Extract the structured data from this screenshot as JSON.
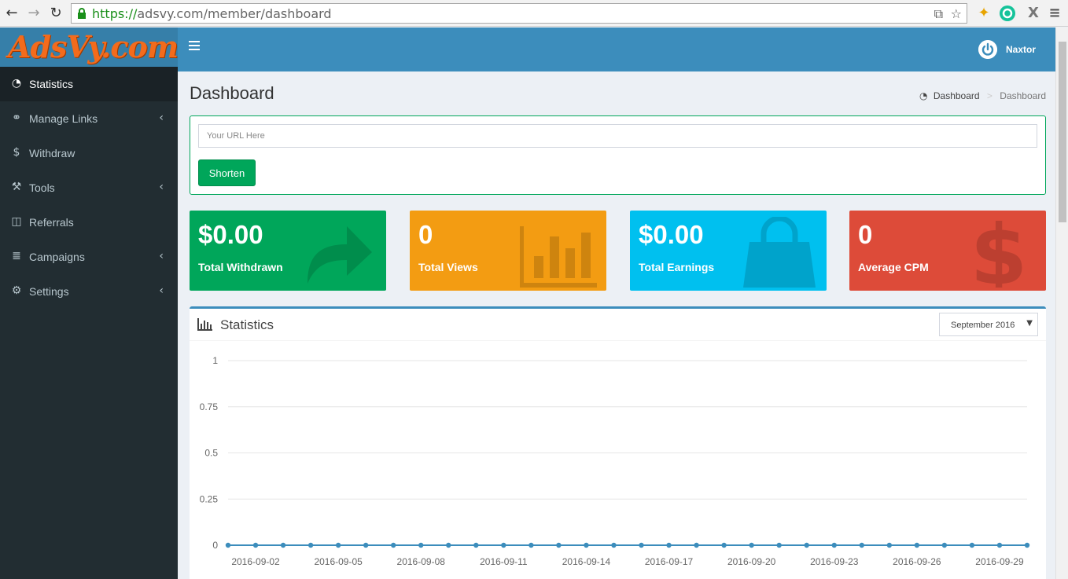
{
  "browser": {
    "url_scheme": "https://",
    "url_rest": "adsvy.com/member/dashboard"
  },
  "sidebar": {
    "logo_text": "AdsVy.com",
    "items": [
      {
        "label": "Statistics",
        "icon": "dashboard-icon",
        "active": true,
        "has_chevron": false
      },
      {
        "label": "Manage Links",
        "icon": "link-icon",
        "active": false,
        "has_chevron": true
      },
      {
        "label": "Withdraw",
        "icon": "dollar-icon",
        "active": false,
        "has_chevron": false
      },
      {
        "label": "Tools",
        "icon": "wrench-icon",
        "active": false,
        "has_chevron": true
      },
      {
        "label": "Referrals",
        "icon": "columns-icon",
        "active": false,
        "has_chevron": false
      },
      {
        "label": "Campaigns",
        "icon": "database-icon",
        "active": false,
        "has_chevron": true
      },
      {
        "label": "Settings",
        "icon": "gears-icon",
        "active": false,
        "has_chevron": true
      }
    ]
  },
  "header": {
    "user_name": "Naxtor"
  },
  "page": {
    "title": "Dashboard",
    "breadcrumb": [
      "Dashboard",
      "Dashboard"
    ]
  },
  "shorten": {
    "placeholder": "Your URL Here",
    "button_label": "Shorten"
  },
  "stat_boxes": [
    {
      "value": "$0.00",
      "label": "Total Withdrawn",
      "color": "#00a65a",
      "icon": "share-arrow-icon"
    },
    {
      "value": "0",
      "label": "Total Views",
      "color": "#f39c12",
      "icon": "bar-chart-icon"
    },
    {
      "value": "$0.00",
      "label": "Total Earnings",
      "color": "#00c0ef",
      "icon": "shopping-bag-icon"
    },
    {
      "value": "0",
      "label": "Average CPM",
      "color": "#dd4b39",
      "icon": "dollar-sign-icon"
    }
  ],
  "statistics": {
    "title": "Statistics",
    "selected_month": "September 2016"
  },
  "chart_data": {
    "type": "line",
    "x": [
      "2016-09-01",
      "2016-09-02",
      "2016-09-03",
      "2016-09-04",
      "2016-09-05",
      "2016-09-06",
      "2016-09-07",
      "2016-09-08",
      "2016-09-09",
      "2016-09-10",
      "2016-09-11",
      "2016-09-12",
      "2016-09-13",
      "2016-09-14",
      "2016-09-15",
      "2016-09-16",
      "2016-09-17",
      "2016-09-18",
      "2016-09-19",
      "2016-09-20",
      "2016-09-21",
      "2016-09-22",
      "2016-09-23",
      "2016-09-24",
      "2016-09-25",
      "2016-09-26",
      "2016-09-27",
      "2016-09-28",
      "2016-09-29",
      "2016-09-30"
    ],
    "x_tick_labels": [
      "2016-09-02",
      "2016-09-05",
      "2016-09-08",
      "2016-09-11",
      "2016-09-14",
      "2016-09-17",
      "2016-09-20",
      "2016-09-23",
      "2016-09-26",
      "2016-09-29"
    ],
    "series": [
      {
        "values": [
          0,
          0,
          0,
          0,
          0,
          0,
          0,
          0,
          0,
          0,
          0,
          0,
          0,
          0,
          0,
          0,
          0,
          0,
          0,
          0,
          0,
          0,
          0,
          0,
          0,
          0,
          0,
          0,
          0,
          0
        ],
        "color": "#3c8dbc"
      }
    ],
    "y_ticks": [
      "0",
      "0.25",
      "0.5",
      "0.75",
      "1"
    ],
    "ylim": [
      0,
      1
    ],
    "grid": true,
    "legend": "none",
    "title": "",
    "xlabel": "",
    "ylabel": ""
  }
}
